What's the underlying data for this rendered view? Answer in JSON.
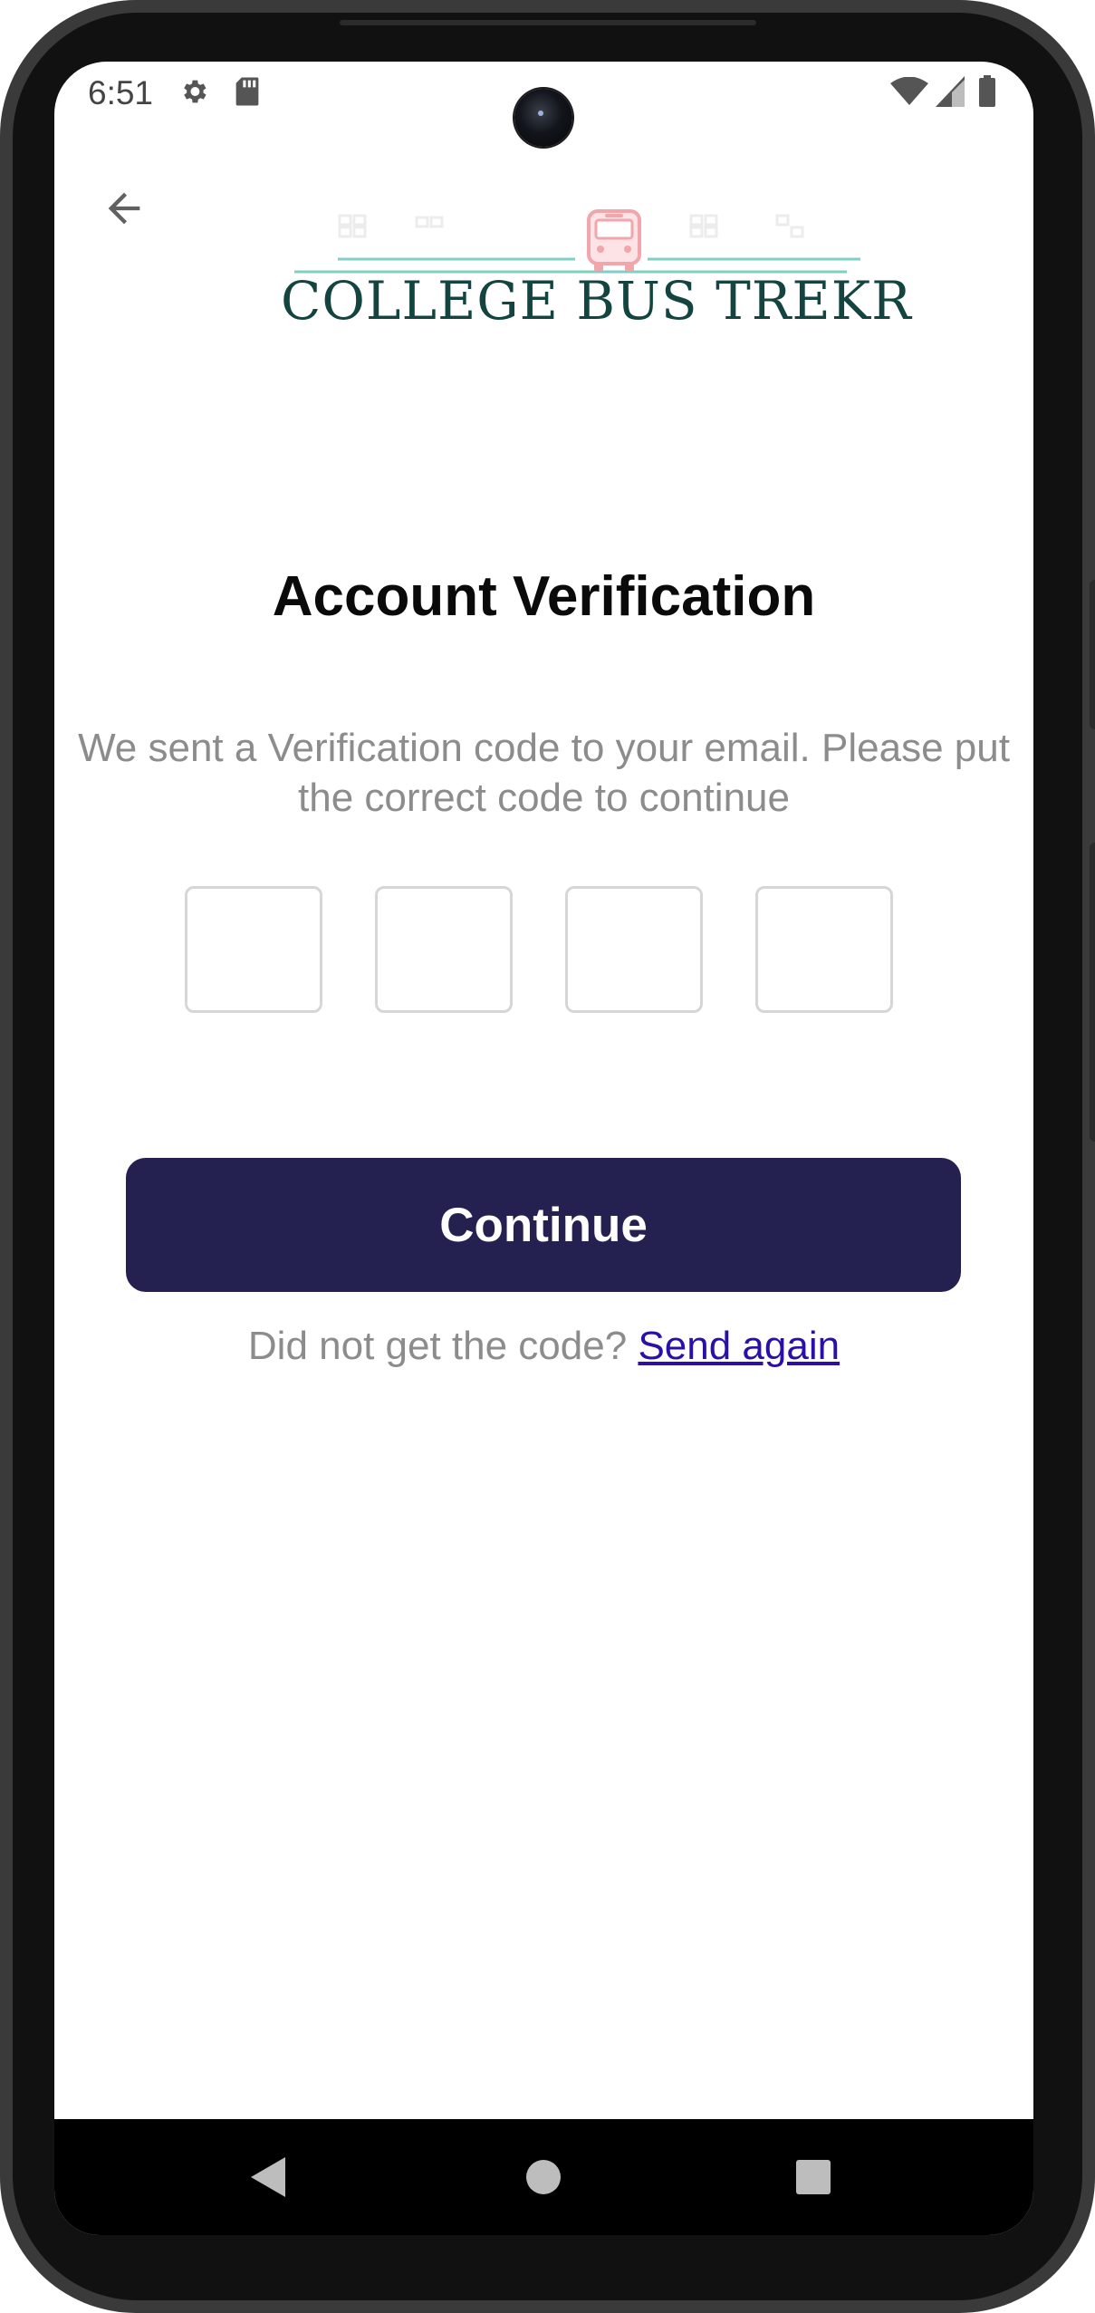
{
  "status_bar": {
    "time": "6:51",
    "icons": [
      "gear-icon",
      "sdcard-icon",
      "wifi-icon",
      "signal-icon",
      "battery-icon"
    ]
  },
  "header": {
    "back_icon": "arrow-left-icon",
    "logo_text": "COLLEGE BUS TREKR"
  },
  "main": {
    "title": "Account Verification",
    "subtitle": "We sent a Verification code to your email. Please put the correct code to continue",
    "otp_digits": [
      "",
      "",
      "",
      ""
    ],
    "continue_label": "Continue",
    "resend_prompt": "Did not get the code?",
    "resend_link": "Send again"
  },
  "nav_bar": {
    "icons": [
      "nav-back-icon",
      "nav-home-icon",
      "nav-recents-icon"
    ]
  },
  "colors": {
    "button_background": "#24204f",
    "link": "#2b0fa6",
    "muted_text": "#8c8c8c",
    "logo_text": "#14443f",
    "logo_accent": "#7fcfc4",
    "logo_bus": "#f1a6ac"
  }
}
